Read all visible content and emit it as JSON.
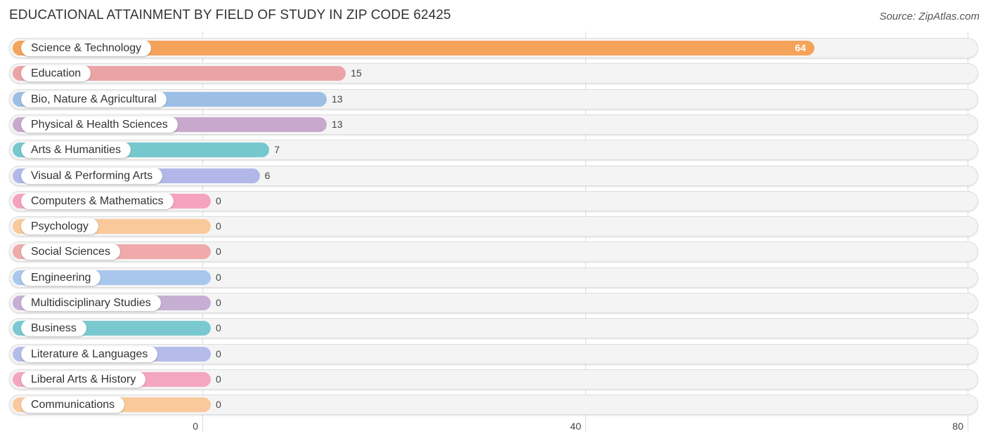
{
  "chart_data": {
    "type": "bar",
    "orientation": "horizontal",
    "title": "EDUCATIONAL ATTAINMENT BY FIELD OF STUDY IN ZIP CODE 62425",
    "source": "Source: ZipAtlas.com",
    "xlabel": "",
    "ylabel": "",
    "xlim": [
      0,
      80
    ],
    "xticks": [
      0,
      40,
      80
    ],
    "grid": true,
    "categories": [
      "Science & Technology",
      "Education",
      "Bio, Nature & Agricultural",
      "Physical & Health Sciences",
      "Arts & Humanities",
      "Visual & Performing Arts",
      "Computers & Mathematics",
      "Psychology",
      "Social Sciences",
      "Engineering",
      "Multidisciplinary Studies",
      "Business",
      "Literature & Languages",
      "Liberal Arts & History",
      "Communications"
    ],
    "values": [
      64,
      15,
      13,
      13,
      7,
      6,
      0,
      0,
      0,
      0,
      0,
      0,
      0,
      0,
      0
    ],
    "colors": [
      "#f5a25a",
      "#eba4a6",
      "#9dbfe6",
      "#c8a8cc",
      "#76c8cf",
      "#b1b8e9",
      "#f5a3bf",
      "#f9c99b",
      "#efaaa9",
      "#a9c7ec",
      "#c7afd4",
      "#7bc9d0",
      "#b5bce9",
      "#f4a6c1",
      "#f9c99c"
    ]
  }
}
